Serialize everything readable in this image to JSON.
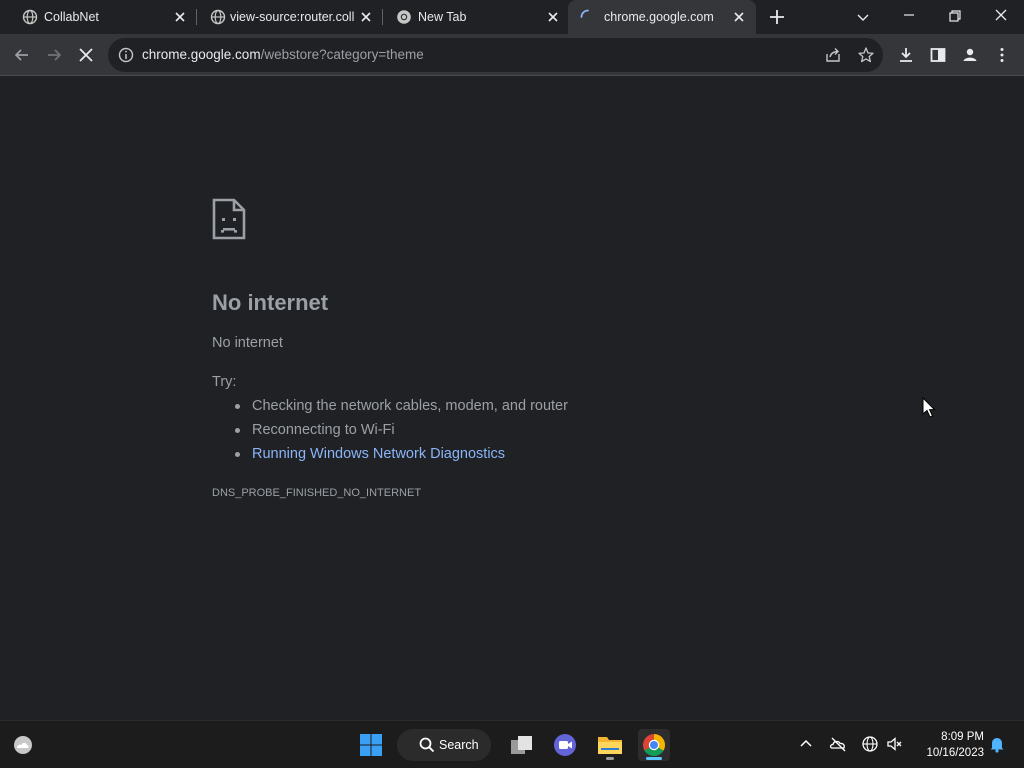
{
  "tabs": [
    {
      "title": "CollabNet",
      "icon": "globe-icon"
    },
    {
      "title": "view-source:router.collab",
      "icon": "globe-icon"
    },
    {
      "title": "New Tab",
      "icon": "chrome-icon"
    },
    {
      "title": "chrome.google.com",
      "icon": "loading-spinner-icon",
      "active": true
    }
  ],
  "omnibox": {
    "host": "chrome.google.com",
    "path": "/webstore?category=theme"
  },
  "error_page": {
    "title": "No internet",
    "subtitle": "No internet",
    "try_label": "Try:",
    "suggestions": [
      "Checking the network cables, modem, and router",
      "Reconnecting to Wi-Fi",
      "Running Windows Network Diagnostics"
    ],
    "error_code": "DNS_PROBE_FINISHED_NO_INTERNET"
  },
  "taskbar": {
    "search_label": "Search",
    "time": "8:09 PM",
    "date": "10/16/2023"
  },
  "colors": {
    "page_bg": "#202124",
    "toolbar_bg": "#35363a",
    "link": "#8ab4f8",
    "text_muted": "#9aa0a6",
    "taskbar_bg": "#1c1c1c"
  }
}
